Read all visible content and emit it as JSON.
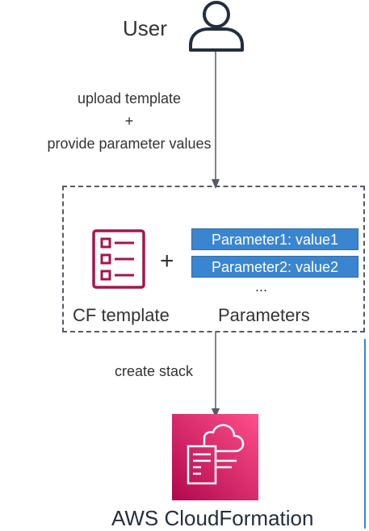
{
  "user": {
    "label": "User",
    "icon": "user-icon"
  },
  "steps": {
    "upload_line1": "upload template",
    "upload_plus": "+",
    "upload_line2": "provide parameter values",
    "create_stack": "create stack"
  },
  "box": {
    "template_icon": "document-list-icon",
    "plus": "+",
    "parameters": [
      "Parameter1: value1",
      "Parameter2: value2"
    ],
    "ellipsis": "...",
    "template_label": "CF template",
    "parameters_label": "Parameters"
  },
  "service": {
    "label": "AWS CloudFormation",
    "icon": "cloudformation-icon"
  },
  "colors": {
    "template_icon": "#a3164f",
    "parameter_fill": "#3a85d0",
    "service_gradient_start": "#b0084d",
    "service_gradient_end": "#ff4f8b",
    "dashed_border": "#545b64"
  }
}
